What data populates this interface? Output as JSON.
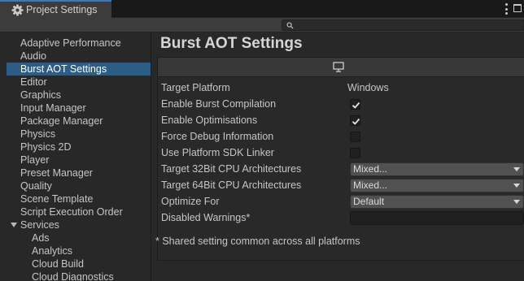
{
  "window": {
    "tab_title": "Project Settings"
  },
  "search": {
    "value": "",
    "placeholder": ""
  },
  "sidebar": {
    "items": [
      {
        "label": "Adaptive Performance"
      },
      {
        "label": "Audio"
      },
      {
        "label": "Burst AOT Settings",
        "selected": true
      },
      {
        "label": "Editor"
      },
      {
        "label": "Graphics"
      },
      {
        "label": "Input Manager"
      },
      {
        "label": "Package Manager"
      },
      {
        "label": "Physics"
      },
      {
        "label": "Physics 2D"
      },
      {
        "label": "Player"
      },
      {
        "label": "Preset Manager"
      },
      {
        "label": "Quality"
      },
      {
        "label": "Scene Template"
      },
      {
        "label": "Script Execution Order"
      },
      {
        "label": "Services",
        "expanded": true
      },
      {
        "label": "Ads"
      },
      {
        "label": "Analytics"
      },
      {
        "label": "Cloud Build"
      },
      {
        "label": "Cloud Diagnostics"
      }
    ]
  },
  "main": {
    "title": "Burst AOT Settings",
    "platform_icon": "monitor-icon",
    "rows": [
      {
        "label": "Target Platform",
        "kind": "text",
        "value": "Windows"
      },
      {
        "label": "Enable Burst Compilation",
        "kind": "checkbox",
        "checked": true
      },
      {
        "label": "Enable Optimisations",
        "kind": "checkbox",
        "checked": true
      },
      {
        "label": "Force Debug Information",
        "kind": "checkbox",
        "checked": false
      },
      {
        "label": "Use Platform SDK Linker",
        "kind": "checkbox",
        "checked": false
      },
      {
        "label": "Target 32Bit CPU Architectures",
        "kind": "dropdown",
        "value": "Mixed..."
      },
      {
        "label": "Target 64Bit CPU Architectures",
        "kind": "dropdown",
        "value": "Mixed..."
      },
      {
        "label": "Optimize For",
        "kind": "dropdown",
        "value": "Default"
      },
      {
        "label": "Disabled Warnings*",
        "kind": "textfield",
        "value": ""
      }
    ],
    "footnote": "* Shared setting common across all platforms"
  },
  "colors": {
    "accent": "#3a79bb",
    "selection": "#2c5d87",
    "background": "#282828"
  }
}
